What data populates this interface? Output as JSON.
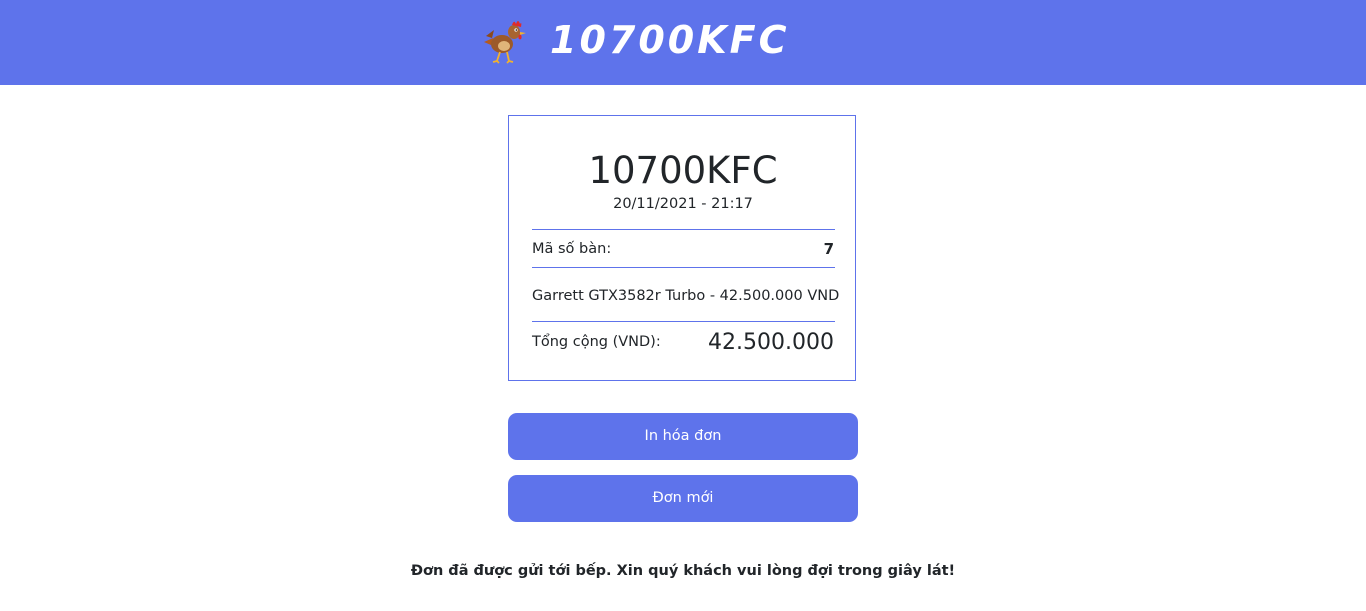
{
  "header": {
    "logo_text": "10700KFC",
    "brand_color": "#5e73eb",
    "mascot_icon": "rooster-mascot-icon"
  },
  "receipt": {
    "title": "10700KFC",
    "datetime": "20/11/2021 - 21:17",
    "table_label": "Mã số bàn:",
    "table_number": "7",
    "items": [
      {
        "text": "Garrett GTX3582r Turbo - 42.500.000 VND"
      }
    ],
    "total_label": "Tổng cộng (VND):",
    "total_value": "42.500.000"
  },
  "actions": {
    "print_label": "In hóa đơn",
    "new_order_label": "Đơn mới"
  },
  "notice": "Đơn đã được gửi tới bếp. Xin quý khách vui lòng đợi trong giây lát!"
}
